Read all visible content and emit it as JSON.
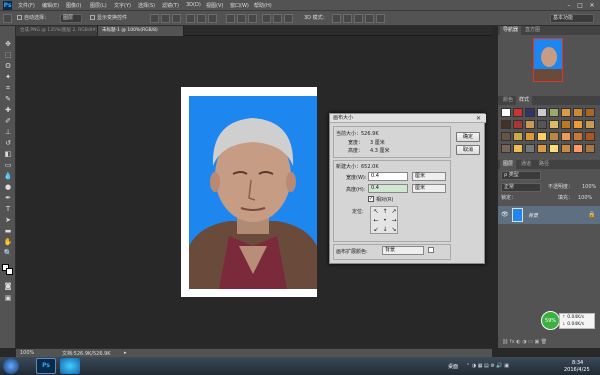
{
  "app": {
    "logo": "Ps"
  },
  "menu": {
    "items": [
      "文件(F)",
      "编辑(E)",
      "图像(I)",
      "图层(L)",
      "文字(Y)",
      "选择(S)",
      "滤镜(T)",
      "3D(D)",
      "视图(V)",
      "窗口(W)",
      "帮助(H)"
    ]
  },
  "options": {
    "auto_select_label": "自动选择：",
    "auto_select_value": "图层",
    "show_transform_label": "显示变换控件",
    "mode_3d_label": "3D 模式：",
    "workspace": "基本功能"
  },
  "tabs": [
    {
      "label": "合成.PNG @ 135%(图层 2, RGB/8#)",
      "active": false
    },
    {
      "label": "未标题-1 @ 100%(RGB/8)",
      "active": true
    }
  ],
  "status": {
    "zoom": "100%",
    "doc": "文档:526.9K/526.9K"
  },
  "dialog": {
    "title": "画布大小",
    "current_size_label": "当前大小：526.9K",
    "current_width_label": "宽度：",
    "current_width_value": "3 厘米",
    "current_height_label": "高度：",
    "current_height_value": "4.3 厘米",
    "new_size_label": "新建大小：652.0K",
    "width_label": "宽度(W):",
    "width_value": "0.4",
    "width_unit": "厘米",
    "height_label": "高度(H):",
    "height_value": "0.4",
    "height_unit": "厘米",
    "relative_label": "相对(R)",
    "anchor_label": "定位:",
    "ext_color_label": "画布扩展颜色:",
    "ext_color_value": "背景",
    "ok_label": "确定",
    "cancel_label": "取消",
    "anchor_glyphs": [
      "↖",
      "↑",
      "↗",
      "←",
      "•",
      "→",
      "↙",
      "↓",
      "↘"
    ]
  },
  "right_panel": {
    "top_tabs": [
      "导航器",
      "直方图"
    ],
    "color_tabs": [
      "颜色",
      "样式"
    ],
    "layers_tabs": [
      "图层",
      "通道",
      "路径"
    ],
    "kind_label": "ρ 类型",
    "blend_mode": "正常",
    "opacity_label": "不透明度：",
    "opacity_value": "100%",
    "lock_label": "锁定：",
    "fill_label": "填充：",
    "fill_value": "100%",
    "layer_name": "背景"
  },
  "net_widget": {
    "percent": "59%",
    "up": "0.04K/s",
    "down": "0.04K/s"
  },
  "taskbar": {
    "desktop_label": "桌面",
    "time": "8:34",
    "date": "2016/4/25"
  },
  "colors": {
    "accent": "#31a8ff",
    "photo_bg": "#1d86ef",
    "widget": "#3cb043"
  }
}
